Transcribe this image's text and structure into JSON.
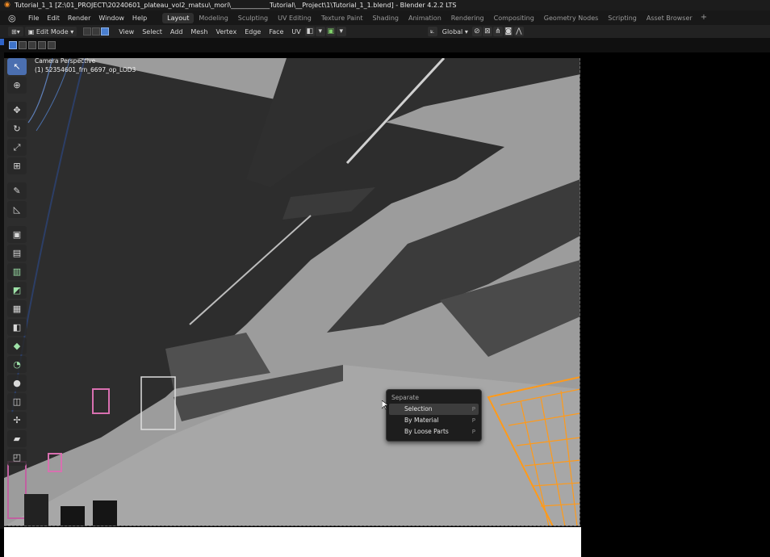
{
  "window": {
    "title": "Tutorial_1_1 [Z:\\01_PROJECT\\20240601_plateau_vol2_matsu\\_mori\\____________Tutorial\\__Project\\1\\Tutorial_1_1.blend] - Blender 4.2.2 LTS"
  },
  "menubar": {
    "items": [
      "File",
      "Edit",
      "Render",
      "Window",
      "Help"
    ],
    "workspaces": [
      "Layout",
      "Modeling",
      "Sculpting",
      "UV Editing",
      "Texture Paint",
      "Shading",
      "Animation",
      "Rendering",
      "Compositing",
      "Geometry Nodes",
      "Scripting",
      "Asset Browser"
    ],
    "active_workspace": "Layout",
    "add_tab": "+"
  },
  "header": {
    "mode": "Edit Mode",
    "menus": [
      "View",
      "Select",
      "Add",
      "Mesh",
      "Vertex",
      "Edge",
      "Face",
      "UV"
    ],
    "transform_orientation": "Global"
  },
  "viewport": {
    "view_name": "Camera Perspective",
    "object_name": "(1) 52354601_frn_6697_op_LOD3"
  },
  "toolbar": {
    "tools": [
      {
        "name": "select-box",
        "icon": "↖",
        "active": true
      },
      {
        "name": "cursor",
        "icon": "⊕"
      },
      {
        "name": "move",
        "icon": "✥"
      },
      {
        "name": "rotate",
        "icon": "↻"
      },
      {
        "name": "scale",
        "icon": "⤢"
      },
      {
        "name": "transform",
        "icon": "⊞"
      },
      {
        "name": "annotate",
        "icon": "✎"
      },
      {
        "name": "measure",
        "icon": "◺"
      },
      {
        "name": "add-cube",
        "icon": "▣"
      },
      {
        "name": "extrude-region",
        "icon": "▤"
      },
      {
        "name": "inset-faces",
        "icon": "▥"
      },
      {
        "name": "bevel",
        "icon": "◩"
      },
      {
        "name": "loop-cut",
        "icon": "▦"
      },
      {
        "name": "knife",
        "icon": "◧"
      },
      {
        "name": "poly-build",
        "icon": "◆"
      },
      {
        "name": "spin",
        "icon": "◔"
      },
      {
        "name": "smooth",
        "icon": "●"
      },
      {
        "name": "edge-slide",
        "icon": "◫"
      },
      {
        "name": "shrink-fatten",
        "icon": "✢"
      },
      {
        "name": "shear",
        "icon": "▰"
      },
      {
        "name": "rip-region",
        "icon": "◰"
      }
    ]
  },
  "context_menu": {
    "title": "Separate",
    "items": [
      {
        "label": "Selection",
        "key": "P"
      },
      {
        "label": "By Material",
        "key": "P"
      },
      {
        "label": "By Loose Parts",
        "key": "P"
      }
    ]
  },
  "colors": {
    "accent": "#4b6fb0",
    "selection_orange": "#ff9a1a",
    "ceiling": "#2c2c2c",
    "wall": "#9a9a9a"
  }
}
